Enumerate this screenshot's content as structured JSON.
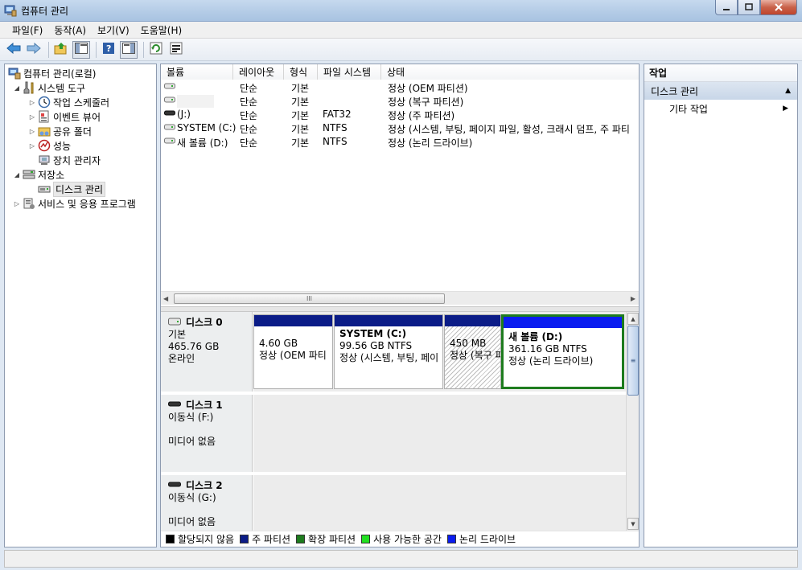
{
  "window": {
    "title": "컴퓨터 관리"
  },
  "menu": [
    "파일(F)",
    "동작(A)",
    "보기(V)",
    "도움말(H)"
  ],
  "toolbar": {
    "buttons": [
      "back-icon",
      "forward-icon",
      "up-folder-icon",
      "show-hide-tree-icon",
      "help-icon",
      "show-hide-action-icon",
      "refresh-icon",
      "properties-icon"
    ]
  },
  "tree": {
    "root": "컴퓨터 관리(로컬)",
    "system_tools": "시스템 도구",
    "task_scheduler": "작업 스케줄러",
    "event_viewer": "이벤트 뷰어",
    "shared_folders": "공유 폴더",
    "performance": "성능",
    "device_manager": "장치 관리자",
    "storage": "저장소",
    "disk_management": "디스크 관리",
    "services_apps": "서비스 및 응용 프로그램"
  },
  "volumes": {
    "headers": [
      "볼륨",
      "레이아웃",
      "형식",
      "파일 시스템",
      "상태"
    ],
    "rows": [
      {
        "name": "",
        "layout": "단순",
        "type": "기본",
        "fs": "",
        "status": "정상 (OEM 파티션)"
      },
      {
        "name": "",
        "layout": "단순",
        "type": "기본",
        "fs": "",
        "status": "정상 (복구 파티션)"
      },
      {
        "name": "(J:)",
        "layout": "단순",
        "type": "기본",
        "fs": "FAT32",
        "status": "정상 (주 파티션)"
      },
      {
        "name": "SYSTEM (C:)",
        "layout": "단순",
        "type": "기본",
        "fs": "NTFS",
        "status": "정상 (시스템, 부팅, 페이지 파일, 활성, 크래시 덤프, 주 파티"
      },
      {
        "name": "새 볼륨 (D:)",
        "layout": "단순",
        "type": "기본",
        "fs": "NTFS",
        "status": "정상 (논리 드라이브)"
      }
    ],
    "scroll_grip": "III"
  },
  "disks": {
    "disk0": {
      "name": "디스크 0",
      "type": "기본",
      "size": "465.76 GB",
      "state": "온라인",
      "partitions": [
        {
          "name": "",
          "size": "4.60 GB",
          "status": "정상 (OEM 파티"
        },
        {
          "name": "SYSTEM  (C:)",
          "size": "99.56 GB NTFS",
          "status": "정상 (시스템, 부팅, 페이"
        },
        {
          "name": "",
          "size": "450 MB",
          "status": "정상 (복구 파"
        },
        {
          "name": "새 볼륨  (D:)",
          "size": "361.16 GB NTFS",
          "status": "정상 (논리 드라이브)"
        }
      ]
    },
    "disk1": {
      "name": "디스크 1",
      "type": "이동식 (F:)",
      "state": "미디어 없음"
    },
    "disk2": {
      "name": "디스크 2",
      "type": "이동식 (G:)",
      "state": "미디어 없음"
    }
  },
  "legend": [
    {
      "label": "할당되지 않음",
      "color": "#000000"
    },
    {
      "label": "주 파티션",
      "color": "#0b1c87"
    },
    {
      "label": "확장 파티션",
      "color": "#1e7c1e"
    },
    {
      "label": "사용 가능한 공간",
      "color": "#22e022"
    },
    {
      "label": "논리 드라이브",
      "color": "#0a1cf0"
    }
  ],
  "actions": {
    "title": "작업",
    "section": "디스크 관리",
    "item": "기타 작업"
  }
}
